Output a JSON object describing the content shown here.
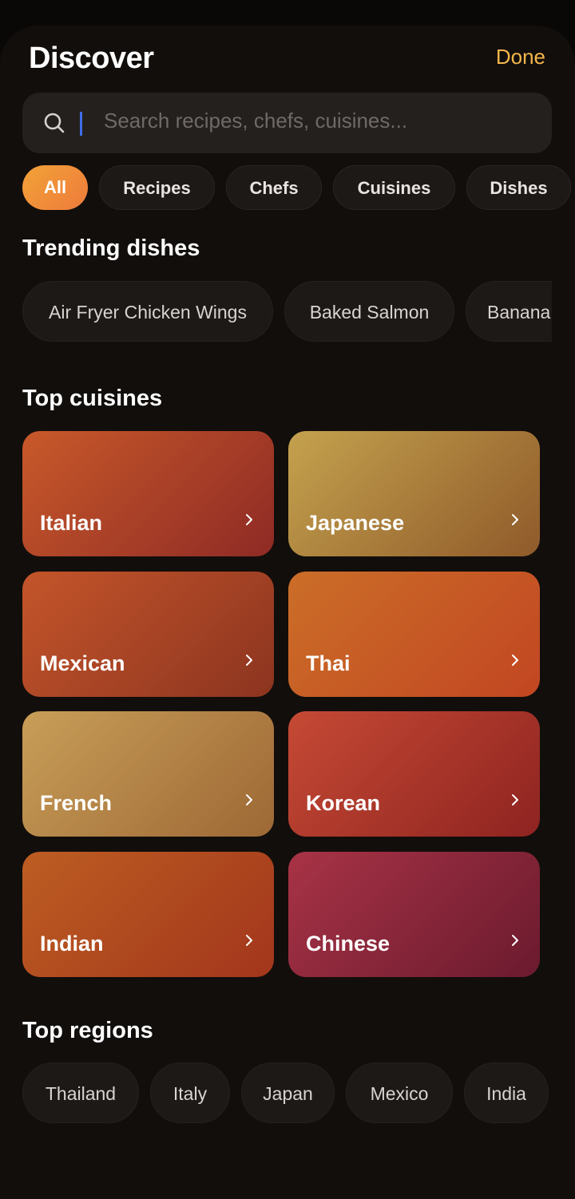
{
  "header": {
    "title": "Discover",
    "done_label": "Done"
  },
  "search": {
    "placeholder": "Search recipes, chefs, cuisines..."
  },
  "filters": [
    {
      "label": "All",
      "active": true
    },
    {
      "label": "Recipes",
      "active": false
    },
    {
      "label": "Chefs",
      "active": false
    },
    {
      "label": "Cuisines",
      "active": false
    },
    {
      "label": "Dishes",
      "active": false
    }
  ],
  "trending": {
    "title": "Trending dishes",
    "items": [
      "Air Fryer Chicken Wings",
      "Baked Salmon",
      "Banana"
    ]
  },
  "cuisines": {
    "title": "Top cuisines",
    "items": [
      {
        "label": "Italian",
        "colors": [
          "#c8592a",
          "#8e2a25"
        ]
      },
      {
        "label": "Japanese",
        "colors": [
          "#c4a24e",
          "#8f5a2a"
        ]
      },
      {
        "label": "Mexican",
        "colors": [
          "#c4552a",
          "#8c3420"
        ]
      },
      {
        "label": "Thai",
        "colors": [
          "#cb6e28",
          "#c24622"
        ]
      },
      {
        "label": "French",
        "colors": [
          "#c89e58",
          "#9d6835"
        ]
      },
      {
        "label": "Korean",
        "colors": [
          "#c64a35",
          "#8e2320"
        ]
      },
      {
        "label": "Indian",
        "colors": [
          "#bd5d22",
          "#a2361c"
        ]
      },
      {
        "label": "Chinese",
        "colors": [
          "#a83346",
          "#6b1a2e"
        ]
      }
    ]
  },
  "regions": {
    "title": "Top regions",
    "items": [
      "Thailand",
      "Italy",
      "Japan",
      "Mexico",
      "India"
    ]
  },
  "colors": {
    "accent": "#f3b64a",
    "background": "#120e0c",
    "chip_active_start": "#f2a238",
    "chip_active_end": "#ee7b3b"
  }
}
